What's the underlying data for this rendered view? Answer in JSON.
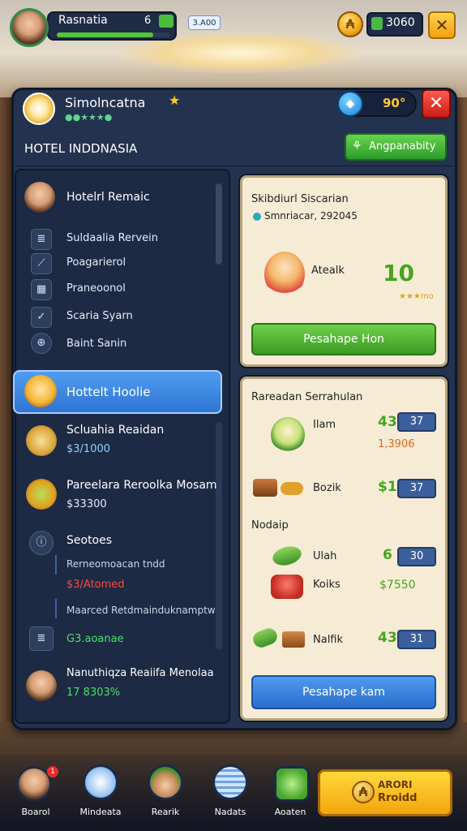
{
  "topbar": {
    "player_name": "Rasnatia",
    "level": "6",
    "xp_progress": 0.85,
    "energy": "3.A00",
    "cash": "3060"
  },
  "panel": {
    "title": "Simolncatna",
    "subtitle": "●●★★★●",
    "gems": "90°",
    "hotel_name": "HOTEL INDDNASIA",
    "action_button": "Angpanabity"
  },
  "left_list": {
    "header_item": "Hotelrl Remaic",
    "sub_items": [
      {
        "icon": "document-icon",
        "label": "Suldaalia Rervein"
      },
      {
        "icon": "wrench-icon",
        "label": "Poagarierol"
      },
      {
        "icon": "building-icon",
        "label": "Praneoonol"
      },
      {
        "icon": "check-icon",
        "label": "Scaria Syarn"
      },
      {
        "icon": "globe-icon",
        "label": "Baint Sanin"
      }
    ],
    "selected_item": "Hottelt Hoolie",
    "entries": [
      {
        "title": "Scluahia Reaidan",
        "value": "$3/1000"
      },
      {
        "title": "Pareelara Reroolka Mosam",
        "value": "$33300"
      }
    ],
    "section": {
      "title": "Seotoes",
      "line1": "Rerneomoacan tndd",
      "line2": "$3/Atomed",
      "line3": "Maarced Retdmainduknamptw"
    },
    "footer_value": "G3.aoanae",
    "last_entry": {
      "title": "Nanuthiqza Reaiifa Menolaa",
      "value": "17 8303%"
    }
  },
  "card1": {
    "title": "Skibdiurl Siscarian",
    "subtitle": "Smnriacar, 292045",
    "character_name": "Atealk",
    "score": "10",
    "stars": "★★★mo",
    "button": "Pesahape Hon"
  },
  "card2": {
    "title": "Rareadan Serrahulan",
    "items": [
      {
        "icon": "chef-icon",
        "name": "Ilam",
        "qty": "43",
        "badge": "37",
        "extra": "1,3906"
      },
      {
        "icon": "wood-icon",
        "name": "Bozik",
        "qty": "$1",
        "badge": "37",
        "extra": ""
      }
    ],
    "section_label": "Nodaip",
    "items2": [
      {
        "icon": "leaf-icon",
        "name": "Ulah",
        "qty": "6",
        "badge": "30",
        "extra": ""
      },
      {
        "icon": "car-icon",
        "name": "Koiks",
        "qty": "",
        "badge": "",
        "extra": "$7550"
      },
      {
        "icon": "sprout-icon",
        "name": "Nalfik",
        "qty": "43",
        "badge": "31",
        "extra": ""
      }
    ],
    "button": "Pesahape kam"
  },
  "bottombar": {
    "notification": "1",
    "items": [
      {
        "icon": "avatar-icon",
        "label": "Boarol"
      },
      {
        "icon": "store-icon",
        "label": "Mindeata"
      },
      {
        "icon": "chef-hat-icon",
        "label": "Rearik"
      },
      {
        "icon": "blinds-icon",
        "label": "Nadats"
      },
      {
        "icon": "plant-icon",
        "label": "Aoaten"
      }
    ],
    "cta_line1": "ARORI",
    "cta_line2": "Rroidd"
  },
  "colors": {
    "panel": "#23334f",
    "green": "#3c9a23",
    "blue": "#2b6dcc",
    "yellow": "#f3a40e"
  }
}
